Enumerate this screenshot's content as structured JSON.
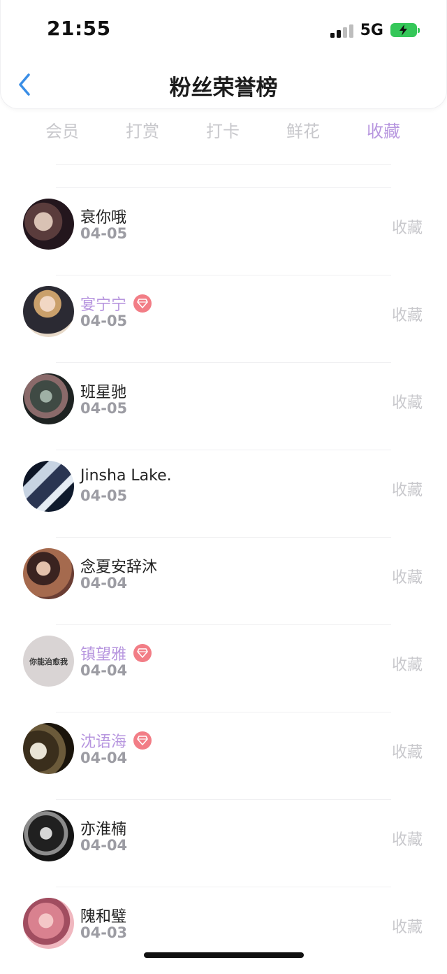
{
  "status": {
    "time": "21:55",
    "network": "5G"
  },
  "header": {
    "title": "粉丝荣誉榜"
  },
  "tabs": [
    {
      "label": "会员",
      "active": false
    },
    {
      "label": "打赏",
      "active": false
    },
    {
      "label": "打卡",
      "active": false
    },
    {
      "label": "鲜花",
      "active": false
    },
    {
      "label": "收藏",
      "active": true
    }
  ],
  "action_label": "收藏",
  "colors": {
    "accent": "#b796df",
    "vip_badge": "#f27d86",
    "muted": "#c8c8cc",
    "battery": "#35c759"
  },
  "fans": [
    {
      "name": "衰你哦",
      "date": "04-05",
      "vip": false,
      "action": "收藏"
    },
    {
      "name": "宴宁宁",
      "date": "04-05",
      "vip": true,
      "action": "收藏"
    },
    {
      "name": "班星驰",
      "date": "04-05",
      "vip": false,
      "action": "收藏"
    },
    {
      "name": "Jinsha Lake.",
      "date": "04-05",
      "vip": false,
      "action": "收藏"
    },
    {
      "name": "念夏安辞沐",
      "date": "04-04",
      "vip": false,
      "action": "收藏"
    },
    {
      "name": "镇望雅",
      "date": "04-04",
      "vip": true,
      "action": "收藏",
      "avatar_text": "你能治愈我"
    },
    {
      "name": "沈语海",
      "date": "04-04",
      "vip": true,
      "action": "收藏"
    },
    {
      "name": "亦淮楠",
      "date": "04-04",
      "vip": false,
      "action": "收藏"
    },
    {
      "name": "隗和璧",
      "date": "04-03",
      "vip": false,
      "action": "收藏"
    }
  ]
}
